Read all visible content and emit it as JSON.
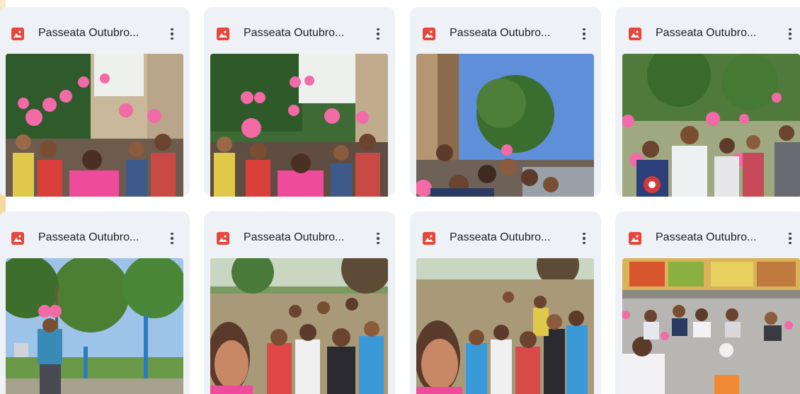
{
  "files": [
    {
      "name": "Passeata Outubro...",
      "type_icon": "image-file-icon",
      "menu_icon": "more-vert-icon"
    },
    {
      "name": "Passeata Outubro...",
      "type_icon": "image-file-icon",
      "menu_icon": "more-vert-icon"
    },
    {
      "name": "Passeata Outubro...",
      "type_icon": "image-file-icon",
      "menu_icon": "more-vert-icon"
    },
    {
      "name": "Passeata Outubro...",
      "type_icon": "image-file-icon",
      "menu_icon": "more-vert-icon"
    },
    {
      "name": "Passeata Outubro...",
      "type_icon": "image-file-icon",
      "menu_icon": "more-vert-icon"
    },
    {
      "name": "Passeata Outubro...",
      "type_icon": "image-file-icon",
      "menu_icon": "more-vert-icon"
    },
    {
      "name": "Passeata Outubro...",
      "type_icon": "image-file-icon",
      "menu_icon": "more-vert-icon"
    },
    {
      "name": "Passeata Outubro...",
      "type_icon": "image-file-icon",
      "menu_icon": "more-vert-icon"
    }
  ],
  "colors": {
    "icon_red": "#e8453c",
    "card_bg": "#eef1f6",
    "balloon_pink": "#f26aa6",
    "shirt_pink": "#ee4c9a"
  }
}
